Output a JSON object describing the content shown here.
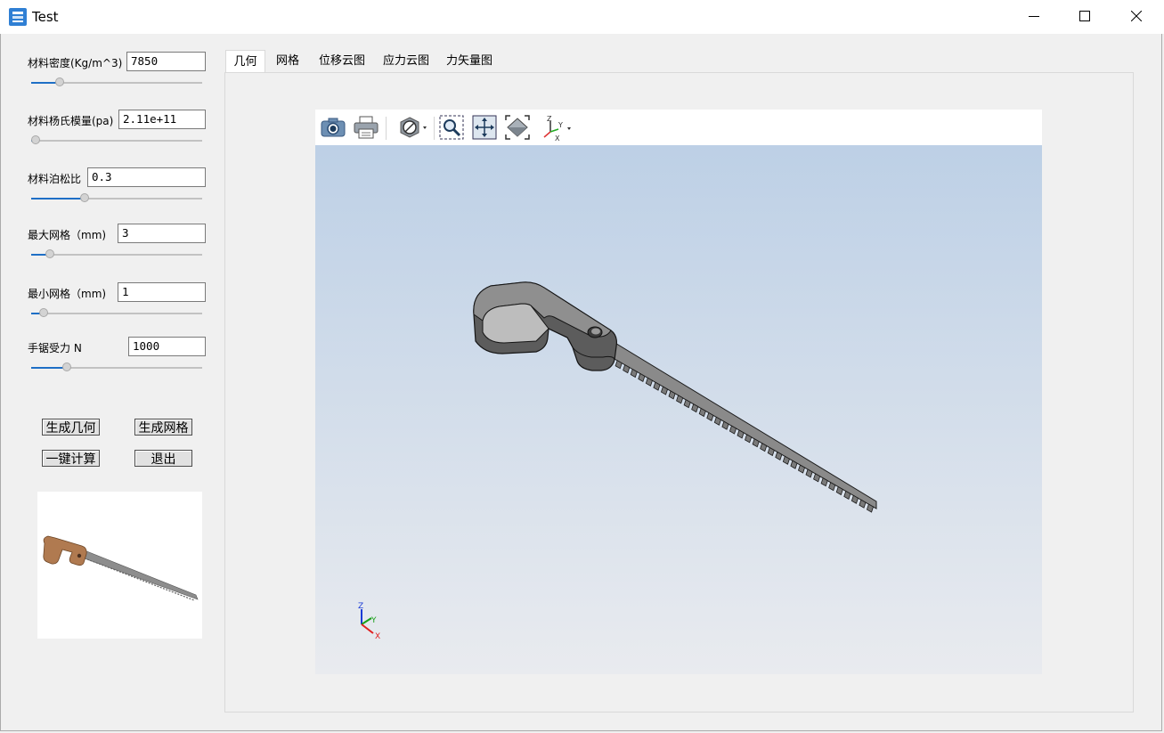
{
  "window": {
    "title": "Test",
    "app_icon": "app-icon",
    "controls": [
      "minimize-icon",
      "maximize-icon",
      "close-icon"
    ]
  },
  "params": [
    {
      "label": "材料密度(Kg/m^3)",
      "value": "7850",
      "slider": 0.15
    },
    {
      "label": "材料杨氏模量(pa)",
      "value": "2.11e+11",
      "slider": 0.0
    },
    {
      "label": "材料泊松比",
      "value": "0.3",
      "slider": 0.3
    },
    {
      "label": "最大网格（mm)",
      "value": "3",
      "slider": 0.09
    },
    {
      "label": "最小网格（mm)",
      "value": "1",
      "slider": 0.05
    },
    {
      "label": "手锯受力 N",
      "value": "1000",
      "slider": 0.19
    }
  ],
  "buttons": {
    "gen_geometry": "生成几何",
    "gen_mesh": "生成网格",
    "compute": "一键计算",
    "exit": "退出"
  },
  "tabs": [
    "几何",
    "网格",
    "位移云图",
    "应力云图",
    "力矢量图"
  ],
  "active_tab": 0,
  "viewer": {
    "toolbar": [
      "camera-icon",
      "print-icon",
      "display-mode-icon",
      "zoom-window-icon",
      "pan-icon",
      "fit-all-icon",
      "view-orientation-icon"
    ],
    "triad_labels": {
      "z": "Z",
      "y": "Y",
      "x": "X"
    },
    "model_color": "#8a8a8a",
    "background_top": "#bdd0e6",
    "background_bottom": "#e9ebef"
  },
  "colors": {
    "accent": "#1e6fc6",
    "handle_preview": "#b07a50"
  }
}
